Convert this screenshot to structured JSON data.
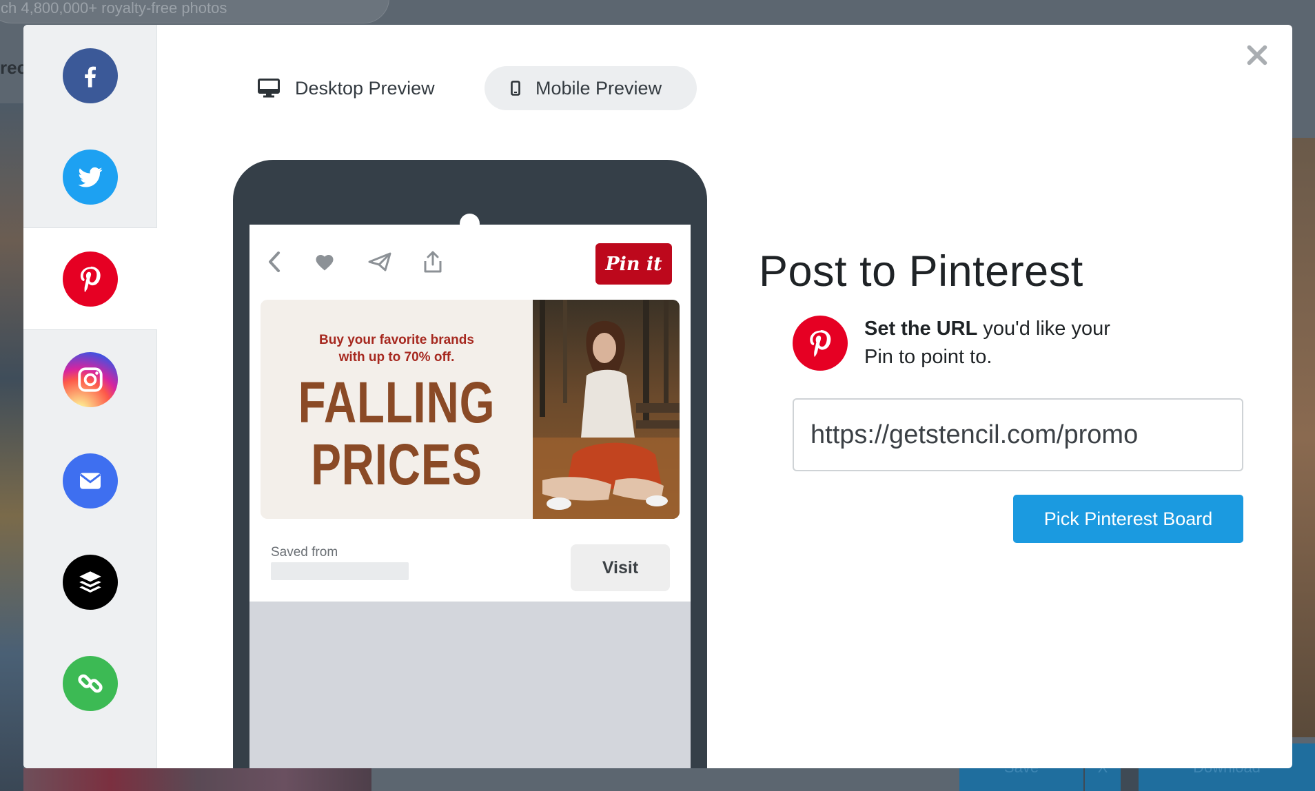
{
  "background": {
    "search_placeholder": "ch 4,800,000+ royalty-free photos",
    "heading_fragment": "rec",
    "bottom_buttons": {
      "save": "Save",
      "close": "X",
      "download": "Download"
    }
  },
  "sidebar": {
    "items": [
      {
        "name": "facebook",
        "icon": "facebook-icon",
        "color": "#3b5998"
      },
      {
        "name": "twitter",
        "icon": "twitter-icon",
        "color": "#1da1f2"
      },
      {
        "name": "pinterest",
        "icon": "pinterest-icon",
        "color": "#e60023",
        "active": true
      },
      {
        "name": "instagram",
        "icon": "instagram-icon",
        "color": "#e1306c"
      },
      {
        "name": "email",
        "icon": "email-icon",
        "color": "#3e6ff0"
      },
      {
        "name": "buffer",
        "icon": "buffer-icon",
        "color": "#000000"
      },
      {
        "name": "link",
        "icon": "link-icon",
        "color": "#3cba54"
      }
    ]
  },
  "close_icon": "close-icon",
  "tabs": {
    "desktop": {
      "label": "Desktop Preview",
      "icon": "monitor-icon"
    },
    "mobile": {
      "label": "Mobile Preview",
      "icon": "phone-icon",
      "active": true
    }
  },
  "preview": {
    "toolbar_icons": [
      "back-chevron-icon",
      "heart-icon",
      "send-icon",
      "share-icon"
    ],
    "pin_it_label": "Pin it",
    "promo": {
      "subtitle_line1": "Buy your favorite brands",
      "subtitle_line2": "with up to 70% off.",
      "title_line1": "FALLING",
      "title_line2": "PRICES"
    },
    "saved_from_label": "Saved from",
    "visit_label": "Visit"
  },
  "panel": {
    "title": "Post to Pinterest",
    "instruction_bold": "Set the URL",
    "instruction_rest": " you'd like your Pin to point to.",
    "url_value": "https://getstencil.com/promo",
    "pick_board_label": "Pick Pinterest Board"
  },
  "colors": {
    "pinterest_red": "#e60023",
    "pin_it_red": "#bd081c",
    "primary_button": "#1b9ae0",
    "phone_body": "#353f48"
  }
}
